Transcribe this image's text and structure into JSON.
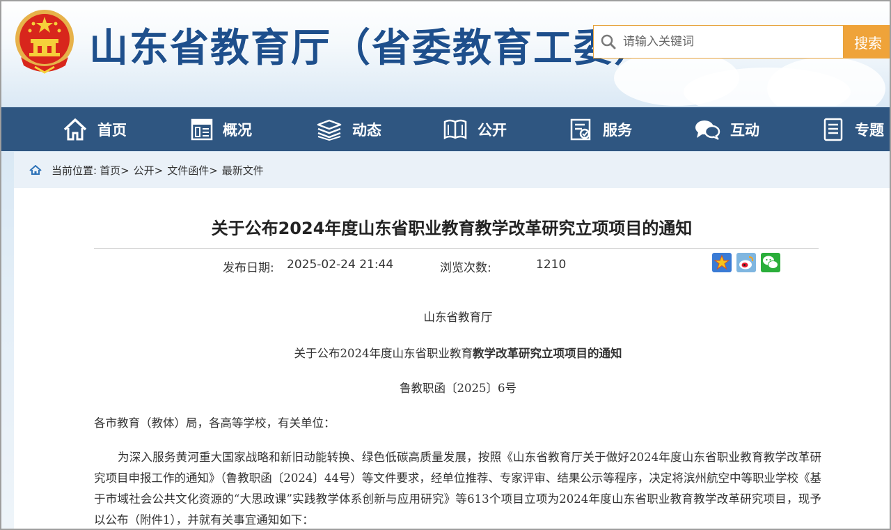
{
  "header": {
    "site_title": "山东省教育厅（省委教育工委）",
    "search_placeholder": "请输入关键词",
    "search_button": "搜索"
  },
  "nav": {
    "items": [
      {
        "label": "首页",
        "icon": "home-icon"
      },
      {
        "label": "概况",
        "icon": "overview-icon"
      },
      {
        "label": "动态",
        "icon": "news-stack-icon"
      },
      {
        "label": "公开",
        "icon": "open-book-icon"
      },
      {
        "label": "服务",
        "icon": "service-form-icon"
      },
      {
        "label": "互动",
        "icon": "chat-bubbles-icon"
      },
      {
        "label": "专题",
        "icon": "document-icon"
      }
    ]
  },
  "breadcrumb": {
    "prefix": "当前位置:",
    "items": [
      "首页>",
      "公开>",
      "文件函件>",
      "最新文件"
    ]
  },
  "article": {
    "title": "关于公布2024年度山东省职业教育教学改革研究立项项目的通知",
    "publish_label": "发布日期:",
    "publish_date": "2025-02-24 21:44",
    "views_label": "浏览次数:",
    "views_count": "1210",
    "share_icons": [
      "favorite-star-icon",
      "weibo-icon",
      "wechat-icon"
    ],
    "issuer": "山东省教育厅",
    "doc_title_part1": "关于公布2024年度山东省职业教育",
    "doc_title_part2": "教学改革研究立项项目的通知",
    "doc_number": "鲁教职函〔2025〕6号",
    "salutation": "各市教育（教体）局，各高等学校，有关单位：",
    "paragraph1": "为深入服务黄河重大国家战略和新旧动能转换、绿色低碳高质量发展，按照《山东省教育厅关于做好2024年度山东省职业教育教学改革研究项目申报工作的通知》（鲁教职函〔2024〕44号）等文件要求，经单位推荐、专家评审、结果公示等程序，决定将滨州航空中等职业学校《基于市域社会公共文化资源的“大思政课”实践教学体系创新与应用研究》等613个项目立项为2024年度山东省职业教育教学改革研究项目，现予以公布（附件1），并就有关事宜通知如下："
  },
  "colors": {
    "brand_blue": "#1e4f8c",
    "nav_bg": "#2f5681",
    "search_accent": "#efa339"
  }
}
